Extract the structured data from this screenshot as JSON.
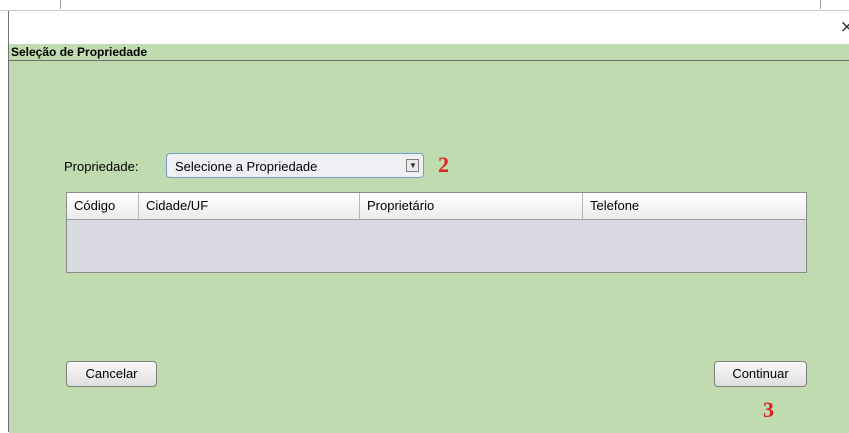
{
  "window": {
    "close_glyph": "×",
    "panel_title": "Seleção de Propriedade"
  },
  "form": {
    "property_label": "Propriedade:",
    "property_select_value": "Selecione a Propriedade",
    "dropdown_arrow": "▼"
  },
  "table": {
    "columns": [
      "Código",
      "Cidade/UF",
      "Proprietário",
      "Telefone"
    ],
    "rows": []
  },
  "buttons": {
    "cancel_label": "Cancelar",
    "continue_label": "Continuar"
  },
  "annotations": {
    "marker_2": "2",
    "marker_3": "3"
  },
  "colors": {
    "panel_background": "#c1dbb1",
    "table_background": "#d8d9e1",
    "annotation_red": "#e02020"
  }
}
